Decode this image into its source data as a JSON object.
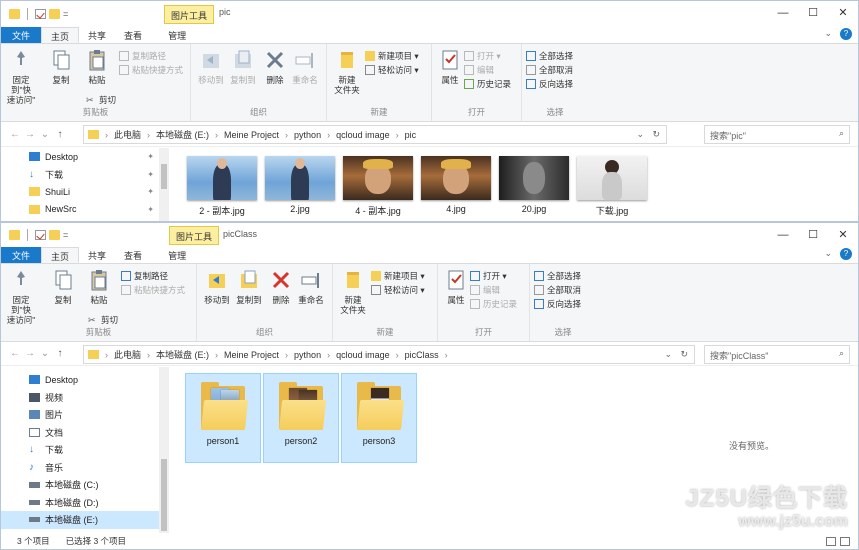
{
  "window1": {
    "qat_dropdown": "=",
    "context_tab": "图片工具",
    "title": "pic",
    "controls": {
      "minimize": "—",
      "maximize": "☐",
      "close": "✕"
    },
    "tabs": [
      "文件",
      "主页",
      "共享",
      "查看",
      "管理"
    ],
    "ribbon": {
      "pin": "固定到\"快\n速访问\"",
      "copy": "复制",
      "paste": "粘贴",
      "copy_path": "复制路径",
      "paste_shortcut": "粘贴快捷方式",
      "cut": "剪切",
      "clipboard_group": "剪贴板",
      "move_to": "移动到",
      "copy_to": "复制到",
      "delete": "删除",
      "rename": "重命名",
      "organize_group": "组织",
      "new_folder": "新建\n文件夹",
      "new_item": "新建项目 ▾",
      "easy_access": "轻松访问 ▾",
      "new_group": "新建",
      "properties": "属性",
      "open": "打开 ▾",
      "edit": "编辑",
      "history": "历史记录",
      "open_group": "打开",
      "select_all": "全部选择",
      "select_none": "全部取消",
      "invert": "反向选择",
      "select_group": "选择"
    },
    "address": {
      "crumbs": [
        "此电脑",
        "本地磁盘 (E:)",
        "Meine Project",
        "python",
        "qcloud image",
        "pic"
      ],
      "search_placeholder": "搜索\"pic\""
    },
    "nav": [
      {
        "label": "Desktop",
        "pinned": true
      },
      {
        "label": "下载",
        "pinned": true
      },
      {
        "label": "ShuiLi",
        "pinned": true
      },
      {
        "label": "NewSrc",
        "pinned": true
      }
    ],
    "files": [
      {
        "name": "2 - 副本.jpg",
        "style": "sky"
      },
      {
        "name": "2.jpg",
        "style": "sky"
      },
      {
        "name": "4 - 副本.jpg",
        "style": "dark"
      },
      {
        "name": "4.jpg",
        "style": "dark"
      },
      {
        "name": "20.jpg",
        "style": "gray"
      },
      {
        "name": "下载.jpg",
        "style": "white"
      }
    ]
  },
  "window2": {
    "qat_dropdown": "=",
    "context_tab": "图片工具",
    "title": "picClass",
    "controls": {
      "minimize": "—",
      "maximize": "☐",
      "close": "✕"
    },
    "tabs": [
      "文件",
      "主页",
      "共享",
      "查看",
      "管理"
    ],
    "address": {
      "crumbs": [
        "此电脑",
        "本地磁盘 (E:)",
        "Meine Project",
        "python",
        "qcloud image",
        "picClass"
      ],
      "search_placeholder": "搜索\"picClass\""
    },
    "nav": [
      {
        "label": "Desktop",
        "icon": "desktop"
      },
      {
        "label": "视频",
        "icon": "video"
      },
      {
        "label": "图片",
        "icon": "picture"
      },
      {
        "label": "文档",
        "icon": "document"
      },
      {
        "label": "下载",
        "icon": "download"
      },
      {
        "label": "音乐",
        "icon": "music"
      },
      {
        "label": "本地磁盘 (C:)",
        "icon": "drive"
      },
      {
        "label": "本地磁盘 (D:)",
        "icon": "drive"
      },
      {
        "label": "本地磁盘 (E:)",
        "icon": "drive",
        "selected": true
      }
    ],
    "folders": [
      {
        "name": "person1"
      },
      {
        "name": "person2"
      },
      {
        "name": "person3"
      }
    ],
    "preview_message": "没有预览。",
    "status": {
      "item_count": "3 个项目",
      "selected_count": "已选择 3 个项目"
    }
  },
  "watermark": {
    "line1": "JZ5U绿色下载",
    "line2": "www.jz5u.com"
  },
  "colors": {
    "file_tab": "#1979ca",
    "selection": "#cce8ff",
    "folder": "#f5cd5a"
  }
}
